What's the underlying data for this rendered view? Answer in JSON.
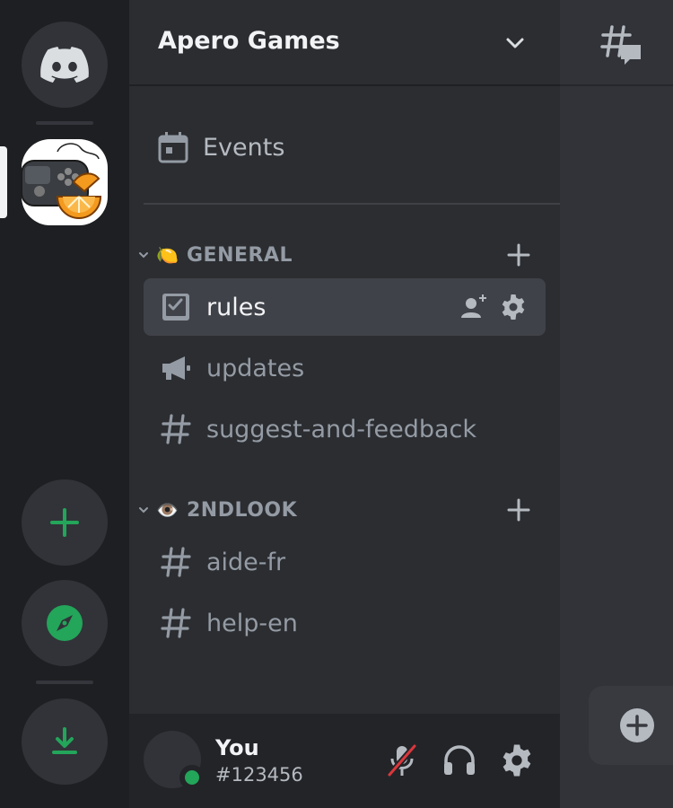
{
  "rail": {
    "home_icon": "discord-logo-icon",
    "server_icon": "gamepad-orange-icon",
    "add_icon": "plus-icon",
    "explore_icon": "compass-icon",
    "download_icon": "download-icon",
    "accent": "#23a55a"
  },
  "guild": {
    "name": "Apero Games",
    "chevron_icon": "chevron-down-icon"
  },
  "events": {
    "label": "Events",
    "icon": "calendar-icon"
  },
  "categories": [
    {
      "emoji": "🍋",
      "label": "GENERAL",
      "channels": [
        {
          "label": "rules",
          "icon": "rules-icon",
          "selected": true
        },
        {
          "label": "updates",
          "icon": "megaphone-icon"
        },
        {
          "label": "suggest-and-feedback",
          "icon": "hash-icon"
        }
      ]
    },
    {
      "emoji": "👁️",
      "label": "2NDLOOK",
      "channels": [
        {
          "label": "aide-fr",
          "icon": "hash-icon"
        },
        {
          "label": "help-en",
          "icon": "hash-icon"
        }
      ]
    }
  ],
  "user": {
    "name": "You",
    "tag": "#123456",
    "status_color": "#23a55a",
    "mic_icon": "mic-muted-icon",
    "headset_icon": "headphones-icon",
    "settings_icon": "gear-icon"
  },
  "right": {
    "threads_icon": "threads-icon",
    "add_icon": "plus-circle-icon"
  }
}
